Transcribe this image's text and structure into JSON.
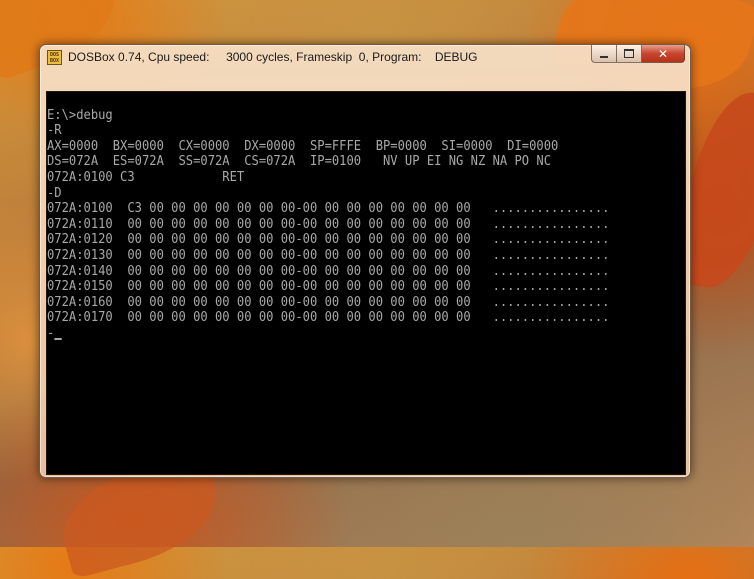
{
  "window": {
    "app_icon_text": "DOS BOX",
    "title": "DOSBox 0.74, Cpu speed:     3000 cycles, Frameskip  0, Program:    DEBUG"
  },
  "console": {
    "lines": [
      "",
      "E:\\>debug",
      "-R",
      "AX=0000  BX=0000  CX=0000  DX=0000  SP=FFFE  BP=0000  SI=0000  DI=0000",
      "DS=072A  ES=072A  SS=072A  CS=072A  IP=0100   NV UP EI NG NZ NA PO NC",
      "072A:0100 C3            RET",
      "-D",
      "072A:0100  C3 00 00 00 00 00 00 00-00 00 00 00 00 00 00 00   ................",
      "072A:0110  00 00 00 00 00 00 00 00-00 00 00 00 00 00 00 00   ................",
      "072A:0120  00 00 00 00 00 00 00 00-00 00 00 00 00 00 00 00   ................",
      "072A:0130  00 00 00 00 00 00 00 00-00 00 00 00 00 00 00 00   ................",
      "072A:0140  00 00 00 00 00 00 00 00-00 00 00 00 00 00 00 00   ................",
      "072A:0150  00 00 00 00 00 00 00 00-00 00 00 00 00 00 00 00   ................",
      "072A:0160  00 00 00 00 00 00 00 00-00 00 00 00 00 00 00 00   ................",
      "072A:0170  00 00 00 00 00 00 00 00-00 00 00 00 00 00 00 00   ................",
      "-"
    ]
  }
}
